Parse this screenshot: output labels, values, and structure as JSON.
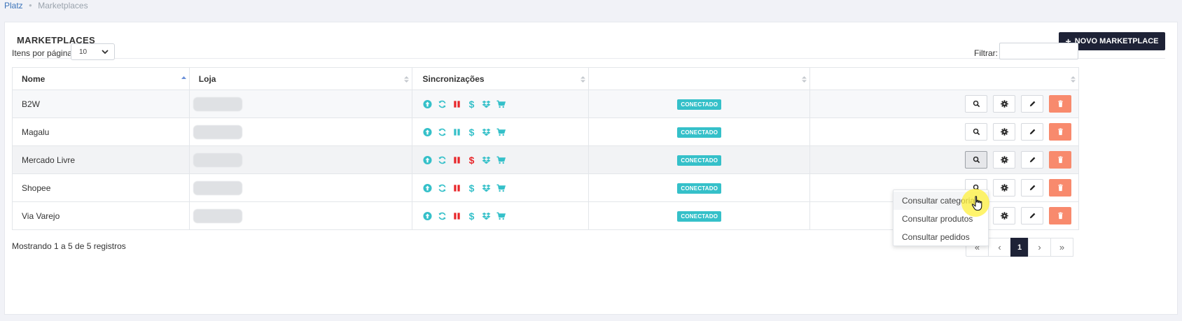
{
  "breadcrumb": {
    "home": "Platz",
    "current": "Marketplaces"
  },
  "card": {
    "title": "MARKETPLACES",
    "new_button": "NOVO MARKETPLACE"
  },
  "controls": {
    "per_page_label": "Itens por página:",
    "per_page_value": "10",
    "filter_label": "Filtrar:",
    "filter_value": ""
  },
  "table": {
    "headers": [
      "Nome",
      "Loja",
      "Sincronizações",
      "",
      ""
    ],
    "rows": [
      {
        "name": "B2W",
        "status": "CONECTADO",
        "dollar_color": "#35c0c9",
        "pause_color": "#e8262a"
      },
      {
        "name": "Magalu",
        "status": "CONECTADO",
        "dollar_color": "#35c0c9",
        "pause_color": "#35c0c9"
      },
      {
        "name": "Mercado Livre",
        "status": "CONECTADO",
        "dollar_color": "#e8262a",
        "pause_color": "#e8262a"
      },
      {
        "name": "Shopee",
        "status": "CONECTADO",
        "dollar_color": "#35c0c9",
        "pause_color": "#e8262a"
      },
      {
        "name": "Via Varejo",
        "status": "CONECTADO",
        "dollar_color": "#35c0c9",
        "pause_color": "#e8262a"
      }
    ]
  },
  "dropdown": {
    "items": [
      "Consultar categorias",
      "Consultar produtos",
      "Consultar pedidos"
    ]
  },
  "footer": {
    "summary": "Mostrando 1 a 5 de 5 registros",
    "pages": [
      "«",
      "‹",
      "1",
      "›",
      "»"
    ]
  },
  "colors": {
    "accent": "#35c0c9",
    "dark": "#1e2236",
    "danger": "#f88a6d",
    "red": "#e8262a"
  }
}
